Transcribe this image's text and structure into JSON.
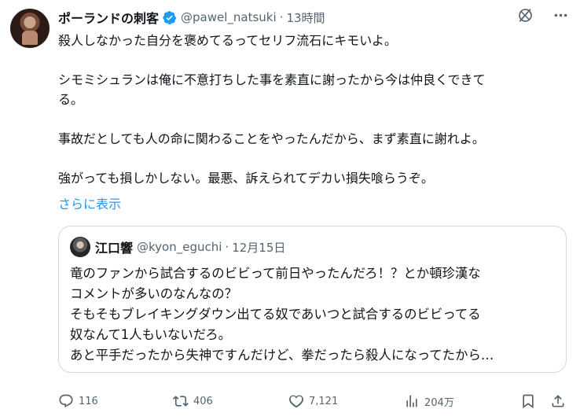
{
  "tweet": {
    "author": {
      "display_name": "ポーランドの刺客",
      "handle": "@pawel_natsuki",
      "verified": true
    },
    "separator": "·",
    "time": "13時間",
    "text_lines": [
      "殺人しなかった自分を褒めてるってセリフ流石にキモいよ。",
      "シモミシュランは俺に不意打ちした事を素直に謝ったから今は仲良くできて",
      "る。",
      "事故だとしても人の命に関わることをやったんだから、まず素直に謝れよ。",
      "強がっても損しかしない。最悪、訴えられてデカい損失喰らうぞ。"
    ],
    "show_more": "さらに表示",
    "top_icons": [
      "grok-icon",
      "more-icon"
    ]
  },
  "quote": {
    "author": {
      "display_name": "江口響",
      "handle": "@kyon_eguchi"
    },
    "separator": "·",
    "time": "12月15日",
    "text_lines": [
      "竜のファンから試合するのビビって前日やったんだろ！？とか頓珍漢な",
      "コメントが多いのなんなの？",
      "そもそもブレイキングダウン出てる奴であいつと試合するのビビってる",
      "奴なんて1人もいないだろ。",
      "あと平手だったから失神ですんだけど、拳だったら殺人になってたから…"
    ]
  },
  "actions": {
    "reply": {
      "icon": "reply-icon",
      "count": "116"
    },
    "retweet": {
      "icon": "retweet-icon",
      "count": "406"
    },
    "like": {
      "icon": "heart-icon",
      "count": "7,121"
    },
    "views": {
      "icon": "views-icon",
      "count": "204万"
    },
    "bookmark": {
      "icon": "bookmark-icon"
    },
    "share": {
      "icon": "share-icon"
    }
  },
  "colors": {
    "text": "#0f1419",
    "secondary": "#536471",
    "link": "#1d9bf0",
    "border": "#cfd9de",
    "verified": "#1d9bf0"
  }
}
